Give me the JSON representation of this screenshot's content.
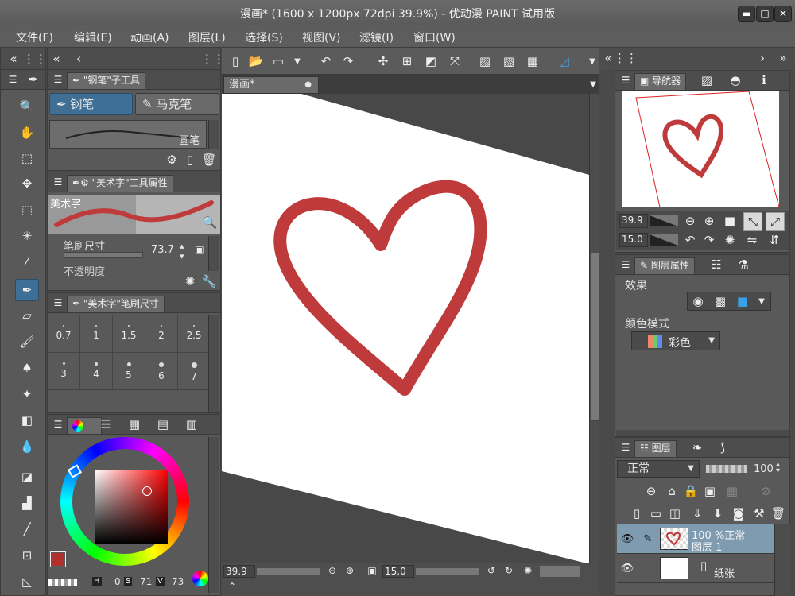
{
  "window": {
    "title": "漫画* (1600 x 1200px 72dpi 39.9%)  - 优动漫 PAINT 试用版",
    "min_label": "▬",
    "max_label": "□",
    "close_label": "✕"
  },
  "menu": [
    "文件(F)",
    "编辑(E)",
    "动画(A)",
    "图层(L)",
    "选择(S)",
    "视图(V)",
    "滤镜(I)",
    "窗口(W)"
  ],
  "subtool_panel": {
    "tab": "\"钢笔\"子工具",
    "subtools": [
      "钢笔",
      "马克笔"
    ],
    "brush_preview_label": "圆笔"
  },
  "tool_property": {
    "tab": "\"美术字\"工具属性",
    "preset_name": "美术字",
    "brush_size_label": "笔刷尺寸",
    "brush_size_value": "73.7",
    "opacity_label": "不透明度"
  },
  "brush_size_panel": {
    "tab": "\"美术字\"笔刷尺寸",
    "sizes": [
      "0.7",
      "1",
      "1.5",
      "2",
      "2.5",
      "3",
      "4",
      "5",
      "6",
      "7"
    ]
  },
  "color_panel": {
    "h_label": "H",
    "h_value": "0",
    "s_label": "S",
    "s_value": "71",
    "v_label": "V",
    "v_value": "73",
    "main_color": "#b03030"
  },
  "document": {
    "tab": "漫画*",
    "zoom": "39.9",
    "angle": "15.0"
  },
  "navigator": {
    "tab": "导航器",
    "zoom": "39.9",
    "angle": "15.0"
  },
  "layer_property": {
    "tab": "图层属性",
    "effect_label": "效果",
    "color_mode_label": "颜色模式",
    "color_mode_value": "彩色"
  },
  "layers_panel": {
    "tab": "图层",
    "blend_mode": "正常",
    "opacity": "100",
    "layers": [
      {
        "line1": "100 %正常",
        "line2": "图层 1"
      },
      {
        "line1": "纸张",
        "line2": ""
      }
    ]
  },
  "accent_color": "#3f6f95",
  "heart_color": "#bf3a3a"
}
